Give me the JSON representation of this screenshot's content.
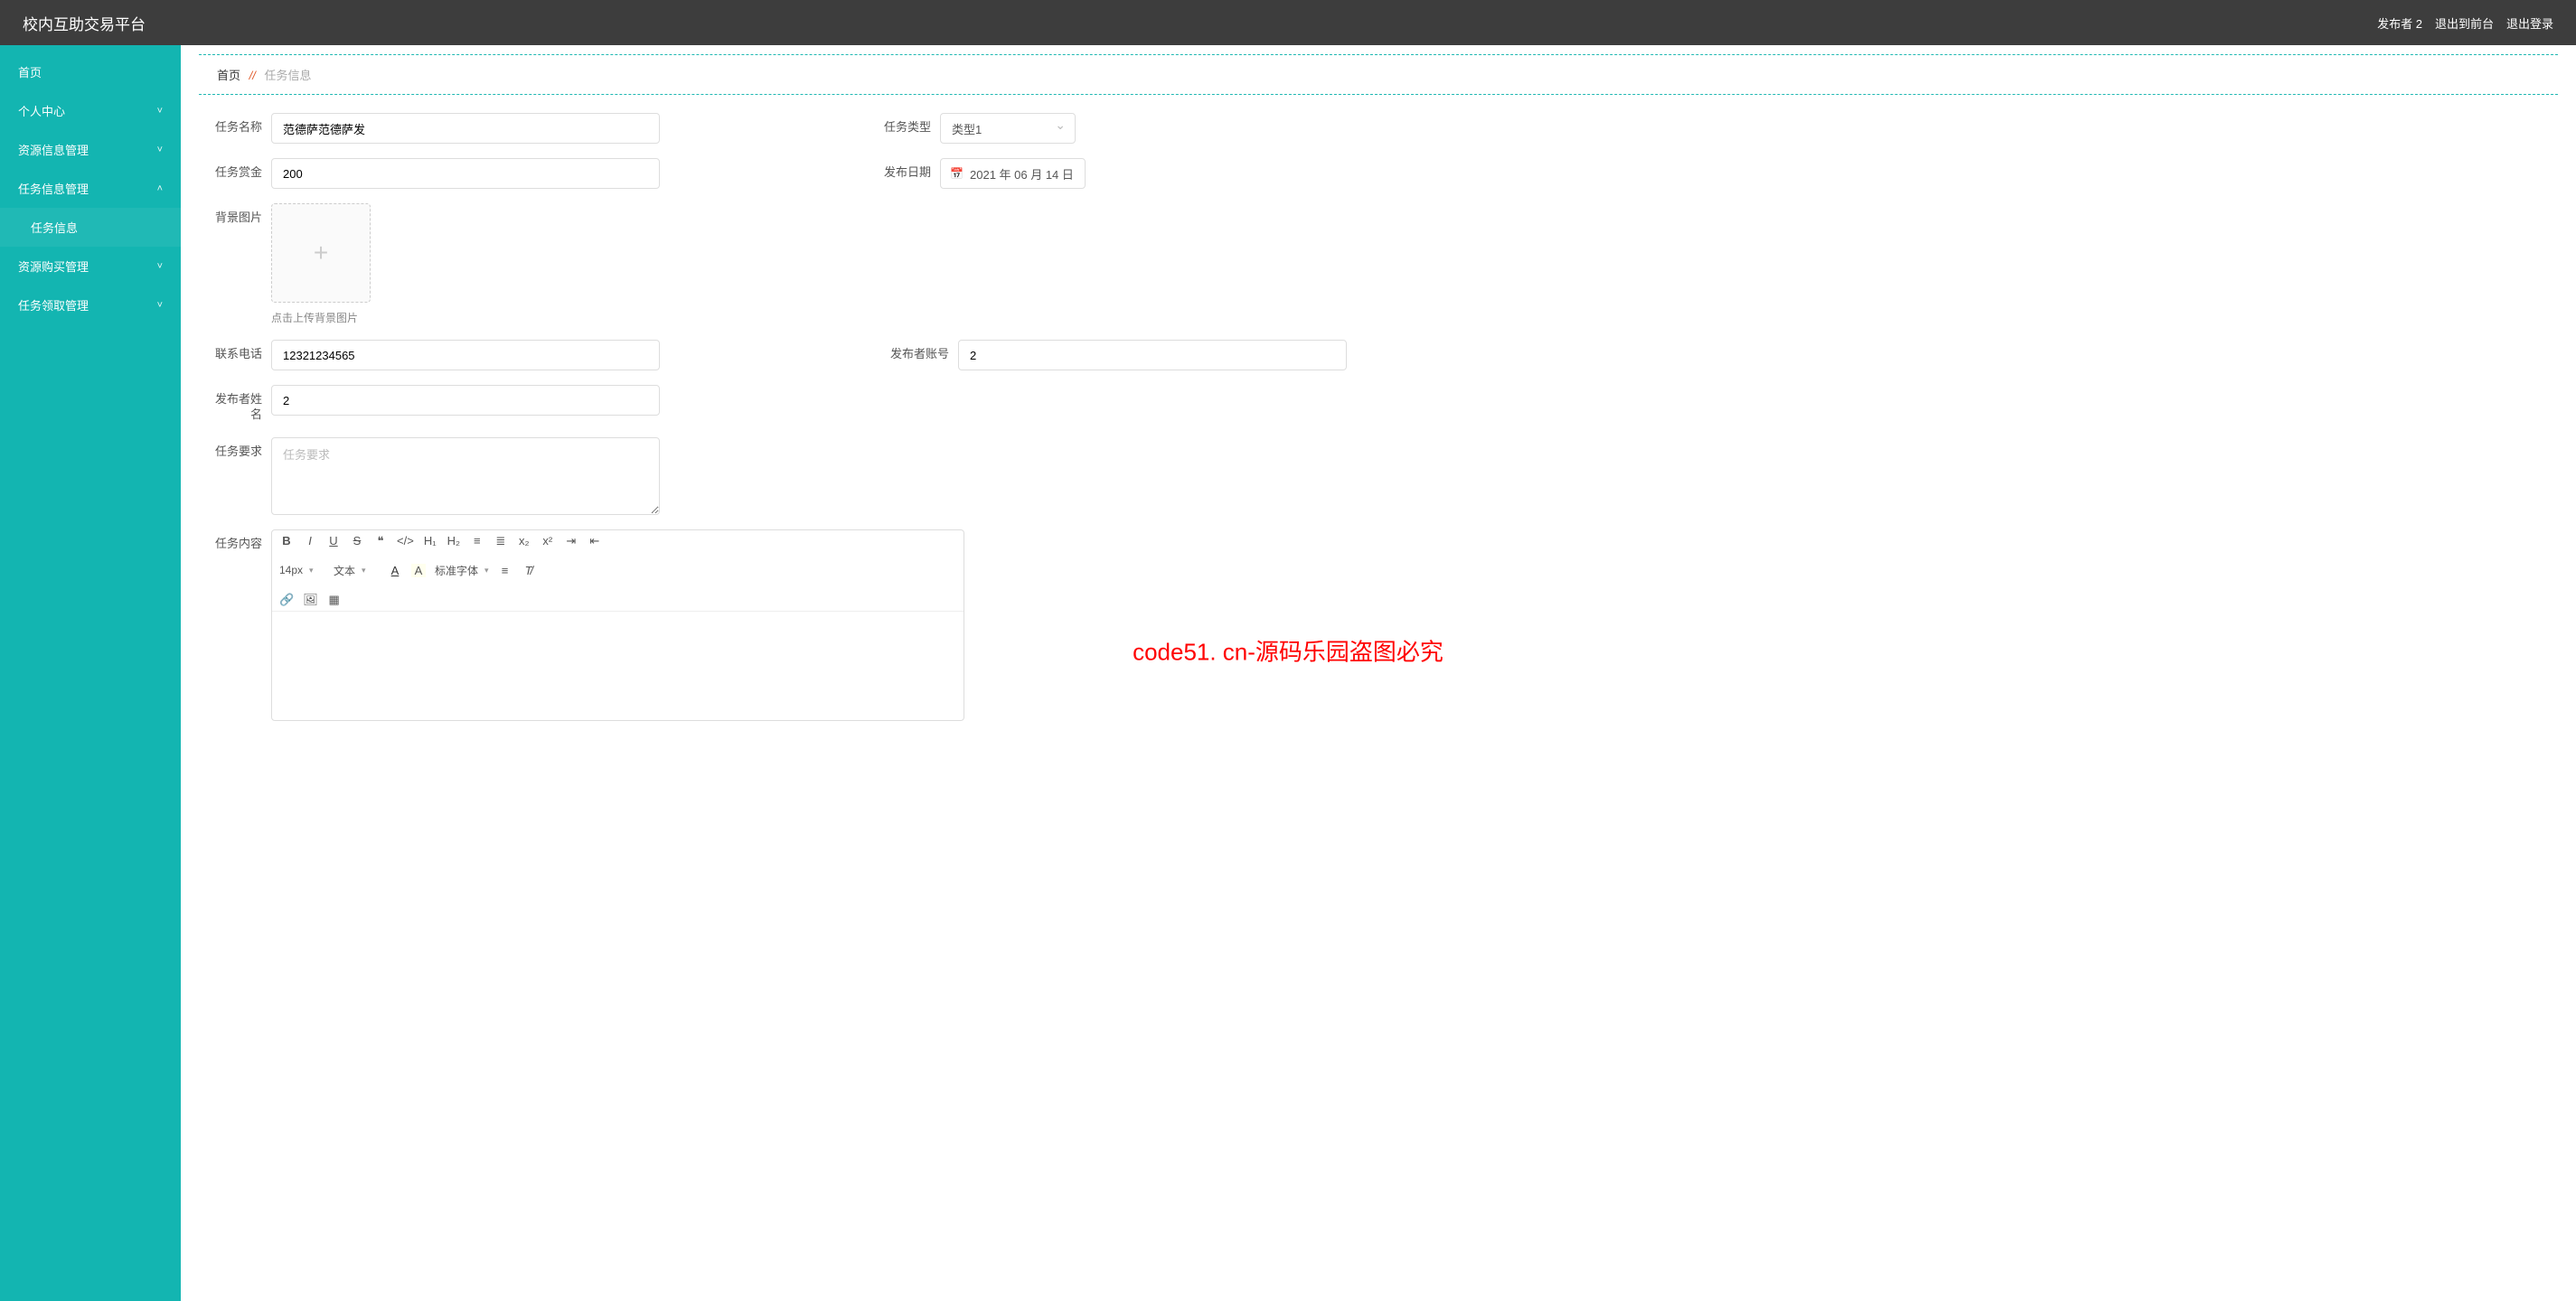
{
  "watermark_text": "code51.cn",
  "overlay_text": "code51. cn-源码乐园盗图必究",
  "header": {
    "title": "校内互助交易平台",
    "user": "发布者 2",
    "to_front": "退出到前台",
    "logout": "退出登录"
  },
  "sidebar": {
    "items": [
      {
        "label": "首页",
        "expandable": false,
        "expanded": false
      },
      {
        "label": "个人中心",
        "expandable": true,
        "expanded": false
      },
      {
        "label": "资源信息管理",
        "expandable": true,
        "expanded": false
      },
      {
        "label": "任务信息管理",
        "expandable": true,
        "expanded": true,
        "children": [
          {
            "label": "任务信息"
          }
        ]
      },
      {
        "label": "资源购买管理",
        "expandable": true,
        "expanded": false
      },
      {
        "label": "任务领取管理",
        "expandable": true,
        "expanded": false
      }
    ]
  },
  "breadcrumb": {
    "home": "首页",
    "sep": "//",
    "current": "任务信息"
  },
  "form": {
    "task_name_label": "任务名称",
    "task_name_value": "范德萨范德萨发",
    "task_type_label": "任务类型",
    "task_type_value": "类型1",
    "reward_label": "任务赏金",
    "reward_value": "200",
    "publish_date_label": "发布日期",
    "publish_date_value": "2021 年 06 月 14 日",
    "bg_image_label": "背景图片",
    "bg_image_hint": "点击上传背景图片",
    "phone_label": "联系电话",
    "phone_value": "12321234565",
    "publisher_acct_label": "发布者账号",
    "publisher_acct_value": "2",
    "publisher_name_label": "发布者姓名",
    "publisher_name_value": "2",
    "requirement_label": "任务要求",
    "requirement_placeholder": "任务要求",
    "content_label": "任务内容"
  },
  "editor_toolbar": {
    "font_size": "14px",
    "format": "文本",
    "font_family": "标准字体"
  }
}
